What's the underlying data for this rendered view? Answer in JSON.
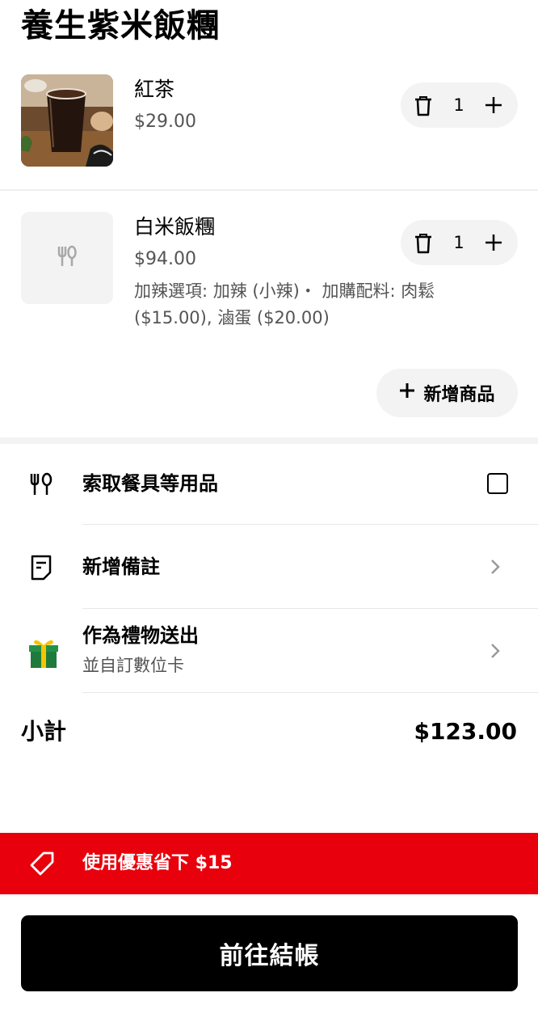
{
  "store": {
    "name": "養生紫米飯糰"
  },
  "cart": {
    "items": [
      {
        "name": "紅茶",
        "price": "$29.00",
        "quantity": "1",
        "options": ""
      },
      {
        "name": "白米飯糰",
        "price": "$94.00",
        "quantity": "1",
        "options": "加辣選項: 加辣 (小辣)・ 加購配料: 肉鬆 ($15.00), 滷蛋 ($20.00)"
      }
    ],
    "add_item_label": "新增商品"
  },
  "extras": {
    "utensils_label": "索取餐具等用品",
    "note_label": "新增備註",
    "gift_label": "作為禮物送出",
    "gift_sub": "並自訂數位卡"
  },
  "summary": {
    "subtotal_label": "小計",
    "subtotal_value": "$123.00"
  },
  "promo": {
    "text": "使用優惠省下 $15"
  },
  "checkout": {
    "label": "前往結帳"
  },
  "colors": {
    "promo_red": "#e8000c",
    "button_black": "#000000",
    "pill_gray": "#f3f3f3"
  },
  "icons": [
    "trash-icon",
    "plus-icon",
    "utensils-icon",
    "note-icon",
    "gift-icon",
    "chevron-right-icon",
    "tag-icon"
  ]
}
